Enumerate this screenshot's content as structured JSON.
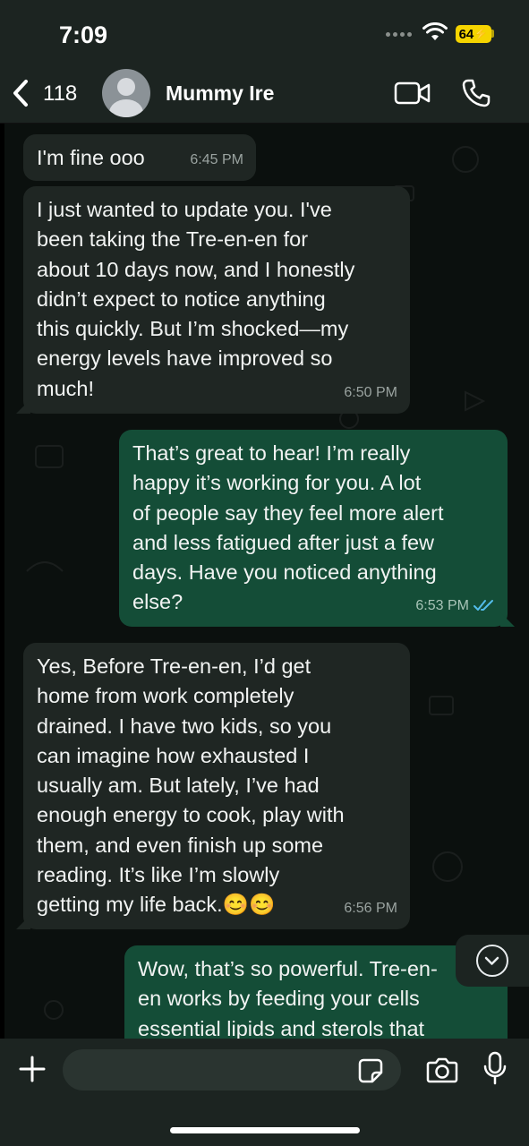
{
  "status_bar": {
    "time": "7:09",
    "battery": "64"
  },
  "header": {
    "back_count": "118",
    "contact_name": "Mummy Ire"
  },
  "messages": [
    {
      "direction": "incoming",
      "text": "I'm fine ooo",
      "time": "6:45 PM"
    },
    {
      "direction": "incoming",
      "text": "I just wanted to update you. I've\nbeen taking the Tre-en-en for\nabout 10 days now, and I honestly\ndidn’t expect to notice anything\nthis quickly. But I’m shocked—my\nenergy levels have improved so\nmuch!",
      "time": "6:50 PM"
    },
    {
      "direction": "outgoing",
      "text": "That’s great to hear! I’m really\nhappy it’s working for you. A lot\nof people say they feel more alert\nand less fatigued after just a few\ndays. Have you noticed anything\nelse?",
      "time": "6:53 PM",
      "status": "read"
    },
    {
      "direction": "incoming",
      "text": "Yes, Before Tre-en-en, I’d get\nhome from work completely\ndrained. I have two kids, so you\ncan imagine how exhausted I\nusually am. But lately, I’ve had\nenough energy to cook, play with\nthem, and even finish up some\nreading. It’s like I’m slowly\ngetting my life back.😊😊",
      "time": "6:56 PM"
    },
    {
      "direction": "outgoing",
      "text": "Wow, that’s so powerful. Tre-en-\nen works by feeding your cells\nessential lipids and sterols that",
      "time": ""
    }
  ],
  "composer": {
    "placeholder": "",
    "value": ""
  },
  "colors": {
    "incoming_bubble": "#1f2623",
    "outgoing_bubble": "#144d37",
    "read_ticks": "#53bdeb",
    "battery": "#f5d400"
  }
}
